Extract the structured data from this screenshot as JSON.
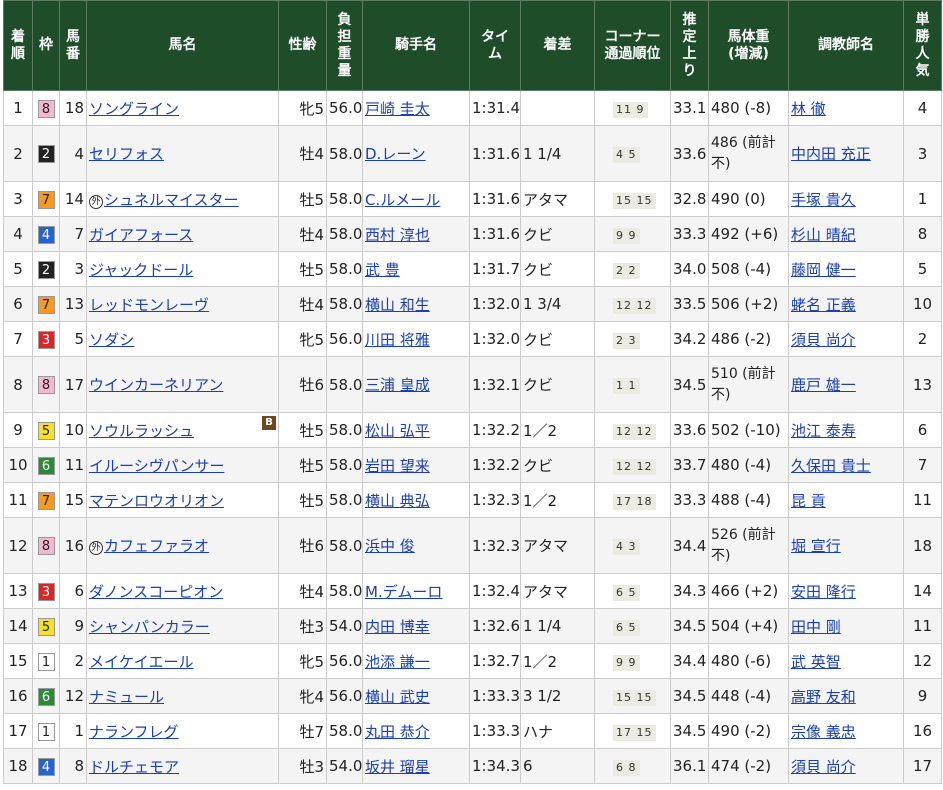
{
  "headers": {
    "rank": "着順",
    "waku": "枠",
    "umaban": "馬番",
    "horse": "馬名",
    "sexage": "性齢",
    "weight": "負担重量",
    "jockey": "騎手名",
    "time": "タイム",
    "margin": "着差",
    "corner": "コーナー通過順位",
    "last3f": "推定上り",
    "bodyweight": "馬体重(増減)",
    "trainer": "調教師名",
    "popularity": "単勝人気"
  },
  "colors": {
    "header_bg": "#1f4d2a",
    "link": "#1a3fb8",
    "waku": {
      "1": {
        "bg": "#ffffff",
        "fg": "#222222"
      },
      "2": {
        "bg": "#222222",
        "fg": "#ffffff"
      },
      "3": {
        "bg": "#e02424",
        "fg": "#ffffff"
      },
      "4": {
        "bg": "#2563cf",
        "fg": "#ffffff"
      },
      "5": {
        "bg": "#f5e12a",
        "fg": "#222222"
      },
      "6": {
        "bg": "#2a8a3a",
        "fg": "#ffffff"
      },
      "7": {
        "bg": "#f59a23",
        "fg": "#222222"
      },
      "8": {
        "bg": "#f7b6cf",
        "fg": "#222222"
      }
    }
  },
  "icons": {
    "foreign": "maru-gai-icon",
    "blinker": "blinker-b-icon"
  },
  "rows": [
    {
      "rank": "1",
      "waku": "8",
      "umaban": "18",
      "mark": "",
      "horse": "ソングライン",
      "blinker": "",
      "sexage": "牝5",
      "weight": "56.0",
      "jockey": "戸崎 圭太",
      "time": "1:31.4",
      "margin": "",
      "corner": "11 9",
      "last3f": "33.1",
      "bodyweight": "480 (-8)",
      "trainer": "林 徹",
      "popularity": "4"
    },
    {
      "rank": "2",
      "waku": "2",
      "umaban": "4",
      "mark": "",
      "horse": "セリフォス",
      "blinker": "",
      "sexage": "牡4",
      "weight": "58.0",
      "jockey": "D.レーン",
      "time": "1:31.6",
      "margin": "1 1/4",
      "corner": "4 5",
      "last3f": "33.6",
      "bodyweight": "486 (前計不)",
      "trainer": "中内田 充正",
      "popularity": "3"
    },
    {
      "rank": "3",
      "waku": "7",
      "umaban": "14",
      "mark": "外",
      "horse": "シュネルマイスター",
      "blinker": "",
      "sexage": "牡5",
      "weight": "58.0",
      "jockey": "C.ルメール",
      "time": "1:31.6",
      "margin": "アタマ",
      "corner": "15 15",
      "last3f": "32.8",
      "bodyweight": "490 (0)",
      "trainer": "手塚 貴久",
      "popularity": "1"
    },
    {
      "rank": "4",
      "waku": "4",
      "umaban": "7",
      "mark": "",
      "horse": "ガイアフォース",
      "blinker": "",
      "sexage": "牡4",
      "weight": "58.0",
      "jockey": "西村 淳也",
      "time": "1:31.6",
      "margin": "クビ",
      "corner": "9 9",
      "last3f": "33.3",
      "bodyweight": "492 (+6)",
      "trainer": "杉山 晴紀",
      "popularity": "8"
    },
    {
      "rank": "5",
      "waku": "2",
      "umaban": "3",
      "mark": "",
      "horse": "ジャックドール",
      "blinker": "",
      "sexage": "牡5",
      "weight": "58.0",
      "jockey": "武 豊",
      "time": "1:31.7",
      "margin": "クビ",
      "corner": "2 2",
      "last3f": "34.0",
      "bodyweight": "508 (-4)",
      "trainer": "藤岡 健一",
      "popularity": "5"
    },
    {
      "rank": "6",
      "waku": "7",
      "umaban": "13",
      "mark": "",
      "horse": "レッドモンレーヴ",
      "blinker": "",
      "sexage": "牡4",
      "weight": "58.0",
      "jockey": "横山 和生",
      "time": "1:32.0",
      "margin": "1 3/4",
      "corner": "12 12",
      "last3f": "33.5",
      "bodyweight": "506 (+2)",
      "trainer": "蛯名 正義",
      "popularity": "10"
    },
    {
      "rank": "7",
      "waku": "3",
      "umaban": "5",
      "mark": "",
      "horse": "ソダシ",
      "blinker": "",
      "sexage": "牝5",
      "weight": "56.0",
      "jockey": "川田 将雅",
      "time": "1:32.0",
      "margin": "クビ",
      "corner": "2 3",
      "last3f": "34.2",
      "bodyweight": "486 (-2)",
      "trainer": "須貝 尚介",
      "popularity": "2"
    },
    {
      "rank": "8",
      "waku": "8",
      "umaban": "17",
      "mark": "",
      "horse": "ウインカーネリアン",
      "blinker": "",
      "sexage": "牡6",
      "weight": "58.0",
      "jockey": "三浦 皇成",
      "time": "1:32.1",
      "margin": "クビ",
      "corner": "1 1",
      "last3f": "34.5",
      "bodyweight": "510 (前計不)",
      "trainer": "鹿戸 雄一",
      "popularity": "13"
    },
    {
      "rank": "9",
      "waku": "5",
      "umaban": "10",
      "mark": "",
      "horse": "ソウルラッシュ",
      "blinker": "B",
      "sexage": "牡5",
      "weight": "58.0",
      "jockey": "松山 弘平",
      "time": "1:32.2",
      "margin": "1／2",
      "corner": "12 12",
      "last3f": "33.6",
      "bodyweight": "502 (-10)",
      "trainer": "池江 泰寿",
      "popularity": "6"
    },
    {
      "rank": "10",
      "waku": "6",
      "umaban": "11",
      "mark": "",
      "horse": "イルーシヴパンサー",
      "blinker": "",
      "sexage": "牡5",
      "weight": "58.0",
      "jockey": "岩田 望来",
      "time": "1:32.2",
      "margin": "クビ",
      "corner": "12 12",
      "last3f": "33.7",
      "bodyweight": "480 (-4)",
      "trainer": "久保田 貴士",
      "popularity": "7"
    },
    {
      "rank": "11",
      "waku": "7",
      "umaban": "15",
      "mark": "",
      "horse": "マテンロウオリオン",
      "blinker": "",
      "sexage": "牡5",
      "weight": "58.0",
      "jockey": "横山 典弘",
      "time": "1:32.3",
      "margin": "1／2",
      "corner": "17 18",
      "last3f": "33.3",
      "bodyweight": "488 (-4)",
      "trainer": "昆 貢",
      "popularity": "11"
    },
    {
      "rank": "12",
      "waku": "8",
      "umaban": "16",
      "mark": "外",
      "horse": "カフェファラオ",
      "blinker": "",
      "sexage": "牡6",
      "weight": "58.0",
      "jockey": "浜中 俊",
      "time": "1:32.3",
      "margin": "アタマ",
      "corner": "4 3",
      "last3f": "34.4",
      "bodyweight": "526 (前計不)",
      "trainer": "堀 宣行",
      "popularity": "18"
    },
    {
      "rank": "13",
      "waku": "3",
      "umaban": "6",
      "mark": "",
      "horse": "ダノンスコーピオン",
      "blinker": "",
      "sexage": "牡4",
      "weight": "58.0",
      "jockey": "M.デムーロ",
      "time": "1:32.4",
      "margin": "アタマ",
      "corner": "6 5",
      "last3f": "34.3",
      "bodyweight": "466 (+2)",
      "trainer": "安田 隆行",
      "popularity": "14"
    },
    {
      "rank": "14",
      "waku": "5",
      "umaban": "9",
      "mark": "",
      "horse": "シャンパンカラー",
      "blinker": "",
      "sexage": "牡3",
      "weight": "54.0",
      "jockey": "内田 博幸",
      "time": "1:32.6",
      "margin": "1 1/4",
      "corner": "6 5",
      "last3f": "34.5",
      "bodyweight": "504 (+4)",
      "trainer": "田中 剛",
      "popularity": "11"
    },
    {
      "rank": "15",
      "waku": "1",
      "umaban": "2",
      "mark": "",
      "horse": "メイケイエール",
      "blinker": "",
      "sexage": "牝5",
      "weight": "56.0",
      "jockey": "池添 謙一",
      "time": "1:32.7",
      "margin": "1／2",
      "corner": "9 9",
      "last3f": "34.4",
      "bodyweight": "480 (-6)",
      "trainer": "武 英智",
      "popularity": "12"
    },
    {
      "rank": "16",
      "waku": "6",
      "umaban": "12",
      "mark": "",
      "horse": "ナミュール",
      "blinker": "",
      "sexage": "牝4",
      "weight": "56.0",
      "jockey": "横山 武史",
      "time": "1:33.3",
      "margin": "3 1/2",
      "corner": "15 15",
      "last3f": "34.5",
      "bodyweight": "448 (-4)",
      "trainer": "高野 友和",
      "popularity": "9"
    },
    {
      "rank": "17",
      "waku": "1",
      "umaban": "1",
      "mark": "",
      "horse": "ナランフレグ",
      "blinker": "",
      "sexage": "牡7",
      "weight": "58.0",
      "jockey": "丸田 恭介",
      "time": "1:33.3",
      "margin": "ハナ",
      "corner": "17 15",
      "last3f": "34.5",
      "bodyweight": "490 (-2)",
      "trainer": "宗像 義忠",
      "popularity": "16"
    },
    {
      "rank": "18",
      "waku": "4",
      "umaban": "8",
      "mark": "",
      "horse": "ドルチェモア",
      "blinker": "",
      "sexage": "牡3",
      "weight": "54.0",
      "jockey": "坂井 瑠星",
      "time": "1:34.3",
      "margin": "6",
      "corner": "6 8",
      "last3f": "36.1",
      "bodyweight": "474 (-2)",
      "trainer": "須貝 尚介",
      "popularity": "17"
    }
  ]
}
